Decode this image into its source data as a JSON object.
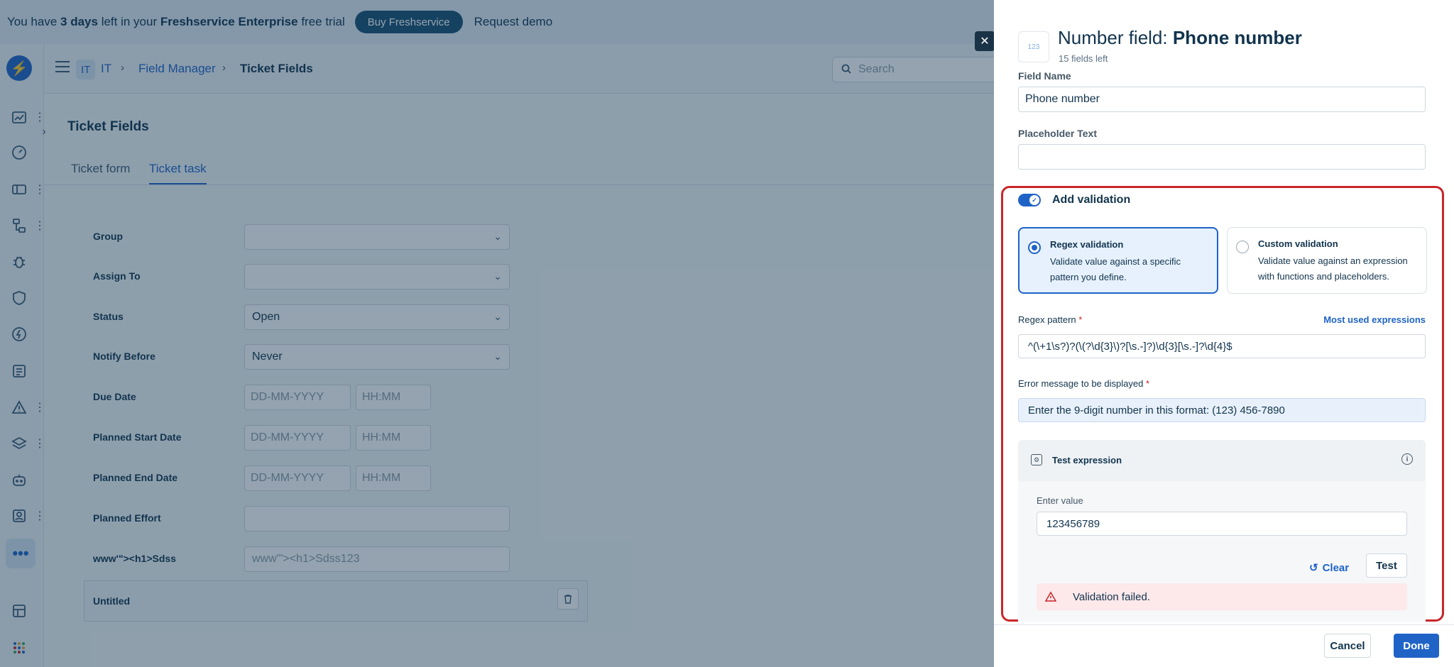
{
  "banner": {
    "text_prefix": "You have ",
    "days": "3 days",
    "text_mid": " left in your ",
    "plan": "Freshservice Enterprise",
    "text_suffix": " free trial",
    "buy_label": "Buy Freshservice",
    "demo_label": "Request demo"
  },
  "topbar": {
    "workspace_chip": "IT",
    "breadcrumb": [
      "IT",
      "Field Manager",
      "Ticket Fields"
    ],
    "search_placeholder": "Search"
  },
  "page": {
    "title": "Ticket Fields",
    "tabs": [
      {
        "label": "Ticket form",
        "active": false
      },
      {
        "label": "Ticket task",
        "active": true
      }
    ]
  },
  "form": {
    "group_label": "Group",
    "assign_label": "Assign To",
    "status_label": "Status",
    "status_value": "Open",
    "notify_label": "Notify Before",
    "notify_value": "Never",
    "due_label": "Due Date",
    "planned_start_label": "Planned Start Date",
    "planned_end_label": "Planned End Date",
    "date_placeholder": "DD-MM-YYYY",
    "time_placeholder": "HH:MM",
    "effort_label": "Planned Effort",
    "custom_label": "www'\"><h1>Sdss",
    "custom_placeholder": "www'\"><h1>Sdss123",
    "untitled_label": "Untitled"
  },
  "drawer": {
    "icon_text": "123",
    "title_prefix": "Number field: ",
    "title_name": "Phone number",
    "fields_left": "15 fields left",
    "field_name_label": "Field Name",
    "field_name_value": "Phone number",
    "placeholder_label": "Placeholder Text",
    "placeholder_value": "",
    "validation_toggle_label": "Add validation",
    "validation_enabled": true,
    "options": [
      {
        "title": "Regex validation",
        "desc": "Validate value against a specific pattern you define.",
        "selected": true
      },
      {
        "title": "Custom validation",
        "desc": "Validate value against an expression with functions and placeholders.",
        "selected": false
      }
    ],
    "regex_label": "Regex pattern",
    "most_used_label": "Most used expressions",
    "regex_value": "^(\\+1\\s?)?(\\(?\\d{3}\\)?[\\s.-]?)\\d{3}[\\s.-]?\\d{4}$",
    "error_label": "Error message to be displayed",
    "error_value": "Enter the 9-digit number in this format: (123) 456-7890",
    "required_mark": "*",
    "test": {
      "title": "Test expression",
      "enter_label": "Enter value",
      "enter_value": "123456789",
      "clear_label": "Clear",
      "test_label": "Test",
      "result": "Validation failed."
    },
    "cancel_label": "Cancel",
    "done_label": "Done"
  },
  "colors": {
    "accent": "#1f63c7",
    "error": "#c8262a",
    "error_bg": "#fde8ea",
    "selected_bg": "#e6f1fd"
  }
}
